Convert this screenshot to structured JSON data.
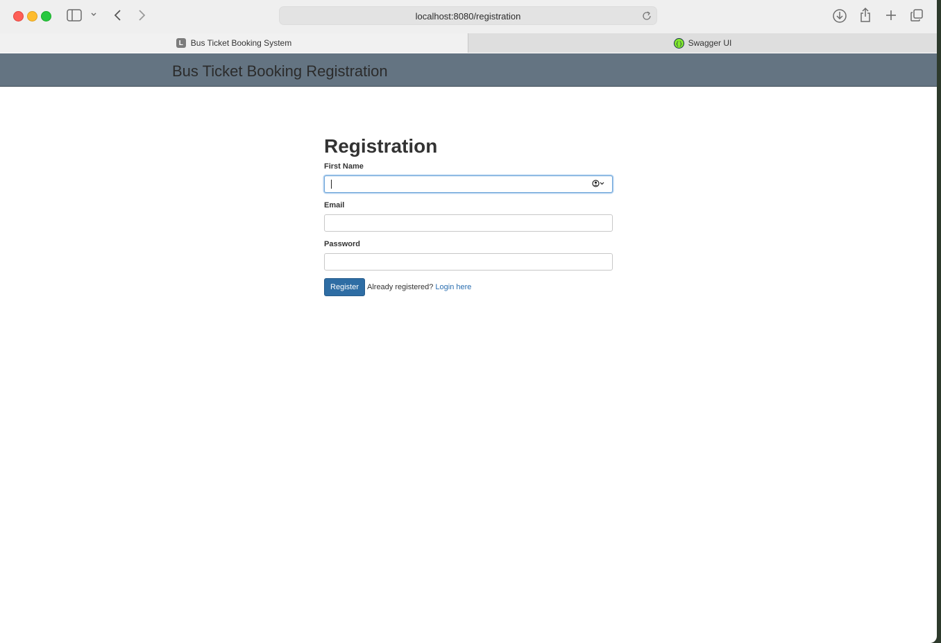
{
  "browser": {
    "url": "localhost:8080/registration",
    "tabs": [
      {
        "label": "Bus Ticket Booking System",
        "favicon": "L"
      },
      {
        "label": "Swagger UI"
      }
    ]
  },
  "header": {
    "brand": "Bus Ticket Booking Registration"
  },
  "form": {
    "title": "Registration",
    "first_name_label": "First Name",
    "first_name_value": "",
    "email_label": "Email",
    "email_value": "",
    "password_label": "Password",
    "password_value": "",
    "register_label": "Register",
    "already_text": "Already registered?",
    "login_link": "Login here"
  },
  "colors": {
    "header_bg": "#647482",
    "button_bg": "#2e6da4",
    "link": "#2a6eb0"
  }
}
